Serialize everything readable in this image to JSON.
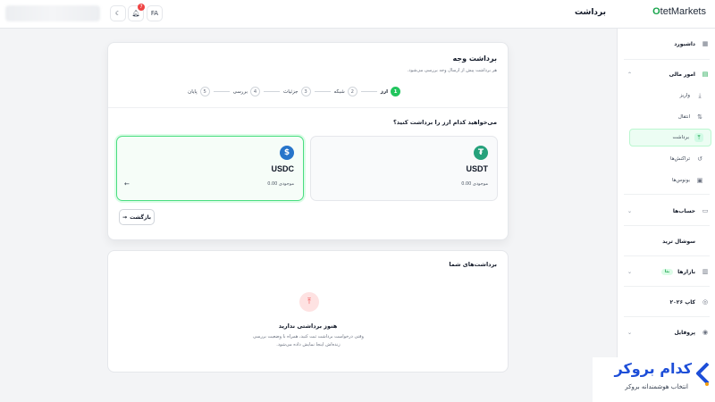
{
  "topbar": {
    "page_title": "برداشت",
    "lang": "FA",
    "notif_count": "7",
    "logo_prefix": "O",
    "logo_main": "tet",
    "logo_suffix": "Markets"
  },
  "sidebar": {
    "items": [
      {
        "label": "داشبورد",
        "icon": "grid-icon"
      },
      {
        "label": "امور مالی",
        "icon": "finance-icon"
      },
      {
        "label": "واریز",
        "icon": "download-icon"
      },
      {
        "label": "انتقال",
        "icon": "transfer-icon"
      },
      {
        "label": "برداشت",
        "icon": "withdraw-icon"
      },
      {
        "label": "تراکنش‌ها",
        "icon": "history-icon"
      },
      {
        "label": "بونوس‌ها",
        "icon": "gift-icon"
      },
      {
        "label": "حساب‌ها",
        "icon": "wallet-icon"
      },
      {
        "label": "سوشال ترید",
        "icon": "social-icon"
      },
      {
        "label": "بازارها",
        "icon": "chart-icon",
        "badge": "بتا"
      },
      {
        "label": "کاپ ۲۰۲۶",
        "icon": "cup-icon"
      },
      {
        "label": "پروفایل",
        "icon": "profile-icon"
      }
    ]
  },
  "withdraw_card": {
    "title": "برداشت وجه",
    "subtitle": "هر برداشت پیش از ارسال وجه بررسی می‌شود.",
    "steps": [
      {
        "num": "1",
        "label": "ارز"
      },
      {
        "num": "2",
        "label": "شبکه"
      },
      {
        "num": "3",
        "label": "جزئیات"
      },
      {
        "num": "4",
        "label": "بررسی"
      },
      {
        "num": "5",
        "label": "پایان"
      }
    ],
    "question": "می‌خواهید کدام ارز را برداشت کنید؟",
    "assets": [
      {
        "name": "USDT",
        "balance": "موجودی 0.00"
      },
      {
        "name": "USDC",
        "balance": "موجودی 0.00"
      }
    ],
    "back_label": "بازگشت"
  },
  "history_card": {
    "title": "برداشت‌های شما",
    "empty_title": "هنوز برداشتی ندارید",
    "empty_line1": "وقتی درخواست برداشت ثبت کنید، همراه با وضعیت بررسی",
    "empty_line2": "زنده‌اش اینجا نمایش داده می‌شود."
  },
  "watermark": {
    "main": "کدام بروکر",
    "sub": "انتخاب هوشمندانه بروکر"
  },
  "colors": {
    "accent": "#22c55e",
    "usdt": "#26a17b",
    "usdc": "#2775ca",
    "watermark": "#1d4ed8"
  }
}
